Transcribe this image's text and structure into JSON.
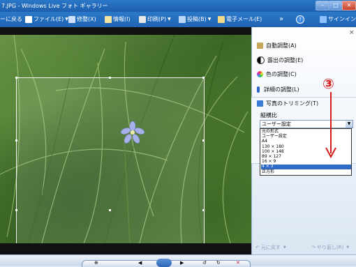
{
  "window": {
    "title": "7.JPG - Windows Live フォト ギャラリー",
    "minimize_glyph": "–",
    "maximize_glyph": "□",
    "close_glyph": "✕"
  },
  "toolbar": {
    "back_label": "ーに戻る",
    "file_label": "ファイル(E)",
    "fix_label": "修整(X)",
    "info_label": "情報(I)",
    "print_label": "印刷(P)",
    "publish_label": "投稿(B)",
    "email_label": "電子メール(E)",
    "more_glyph": "»",
    "help_glyph": "?",
    "signin_label": "サインイン(S)"
  },
  "panel": {
    "close_glyph": "×",
    "auto_adjust": "自動調整(A)",
    "exposure": "露出の調整(E)",
    "color": "色の調整(C)",
    "detail": "詳細の調整(L)",
    "trim": "写真のトリミング(T)",
    "aspect_label": "縦横比",
    "aspect_value": "ユーザー設定",
    "annotation_number": "③",
    "options": [
      "元の形式",
      "ユーザー設定",
      "A4",
      "130 × 180",
      "100 × 148",
      "89 × 127",
      "16 × 9",
      "4 × 3",
      "正方形"
    ],
    "selected_index": 7,
    "undo_label": "元に戻す",
    "redo_label": "やり直し(R)"
  },
  "colors": {
    "titlebar": "#1e5fae",
    "panel_bg": "#e9f0f9",
    "selection": "#316ac5",
    "annotation": "#d21c1c"
  },
  "icons": [
    "home-icon",
    "file-icon",
    "fix-icon",
    "tag-icon",
    "printer-icon",
    "publish-icon",
    "email-icon",
    "help-icon",
    "user-icon",
    "wand-icon",
    "exposure-icon",
    "color-icon",
    "thermometer-icon",
    "crop-icon",
    "undo-icon",
    "redo-icon"
  ]
}
